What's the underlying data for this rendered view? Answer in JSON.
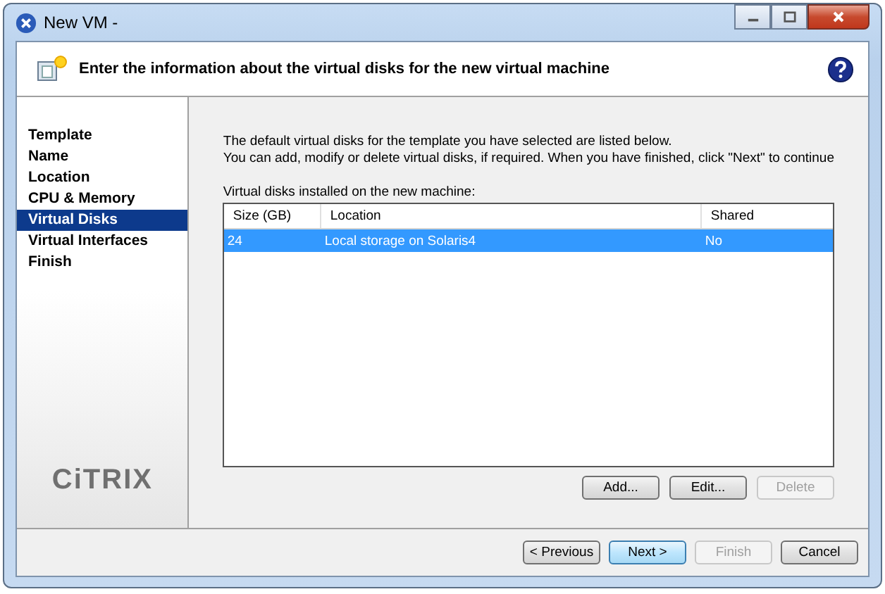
{
  "window": {
    "title": "New VM -"
  },
  "header": {
    "text": "Enter the information about the virtual disks for the new virtual machine"
  },
  "steps": [
    {
      "label": "Template",
      "selected": false
    },
    {
      "label": "Name",
      "selected": false
    },
    {
      "label": "Location",
      "selected": false
    },
    {
      "label": "CPU & Memory",
      "selected": false
    },
    {
      "label": "Virtual Disks",
      "selected": true
    },
    {
      "label": "Virtual Interfaces",
      "selected": false
    },
    {
      "label": "Finish",
      "selected": false
    }
  ],
  "logo": "CiTRIX",
  "intro": [
    "The default virtual disks for the template you have selected are listed below.",
    "You can add, modify or delete virtual disks, if required. When you have finished, click \"Next\" to continue"
  ],
  "table": {
    "label": "Virtual disks installed on the new machine:",
    "columns": [
      "Size (GB)",
      "Location",
      "Shared"
    ],
    "rows": [
      {
        "cells": [
          "24",
          "Local storage on Solaris4",
          "No"
        ],
        "selected": true
      }
    ]
  },
  "disk_buttons": [
    {
      "label": "Add...",
      "disabled": false
    },
    {
      "label": "Edit...",
      "disabled": false
    },
    {
      "label": "Delete",
      "disabled": true
    }
  ],
  "nav_buttons": [
    {
      "label": "< Previous",
      "disabled": false,
      "focused": false
    },
    {
      "label": "Next >",
      "disabled": false,
      "focused": true
    },
    {
      "label": "Finish",
      "disabled": true,
      "focused": false
    },
    {
      "label": "Cancel",
      "disabled": false,
      "focused": false
    }
  ]
}
